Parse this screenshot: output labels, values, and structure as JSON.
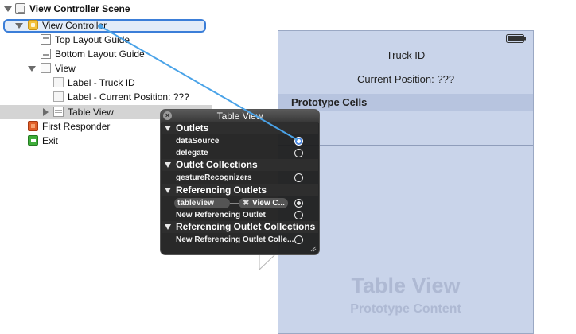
{
  "outline": {
    "items": [
      {
        "label": "View Controller Scene",
        "icon": "scene-icon"
      },
      {
        "label": "View Controller",
        "icon": "view-controller-icon"
      },
      {
        "label": "Top Layout Guide",
        "icon": "layout-guide-icon"
      },
      {
        "label": "Bottom Layout Guide",
        "icon": "layout-guide-icon"
      },
      {
        "label": "View",
        "icon": "view-icon"
      },
      {
        "label": "Label - Truck ID",
        "icon": "label-icon"
      },
      {
        "label": "Label - Current Position: ???",
        "icon": "label-icon"
      },
      {
        "label": "Table View",
        "icon": "table-view-icon"
      },
      {
        "label": "First Responder",
        "icon": "first-responder-icon"
      },
      {
        "label": "Exit",
        "icon": "exit-icon"
      }
    ]
  },
  "canvas": {
    "truck_id": "Truck ID",
    "current_position": "Current Position: ???",
    "prototype_cells": "Prototype Cells",
    "watermark_title": "Table View",
    "watermark_subtitle": "Prototype Content"
  },
  "hud": {
    "title": "Table View",
    "sections": [
      {
        "label": "Outlets",
        "items": [
          {
            "label": "dataSource",
            "connected": true
          },
          {
            "label": "delegate",
            "connected": false
          }
        ]
      },
      {
        "label": "Outlet Collections",
        "items": [
          {
            "label": "gestureRecognizers",
            "connected": false
          }
        ]
      },
      {
        "label": "Referencing Outlets",
        "items": [
          {
            "label": "tableView",
            "connected": true,
            "target": "View C..."
          },
          {
            "label": "New Referencing Outlet",
            "connected": false
          }
        ]
      },
      {
        "label": "Referencing Outlet Collections",
        "items": [
          {
            "label": "New Referencing Outlet Colle...",
            "connected": false
          }
        ]
      }
    ]
  },
  "colors": {
    "selection": "#3b7ed8",
    "connection_line": "#4aa3e8",
    "view_background": "#c9d4ea",
    "hud_background": "#1c1c1c"
  }
}
